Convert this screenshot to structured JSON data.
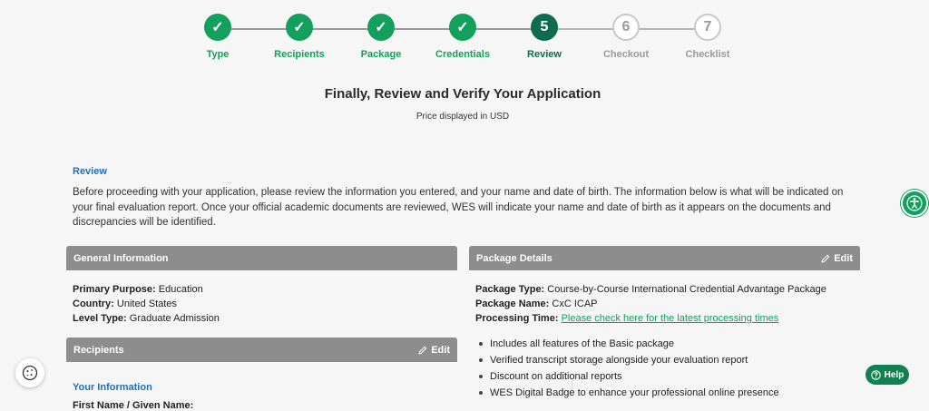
{
  "stepper": {
    "steps": [
      {
        "num": "1",
        "mark": "✓",
        "label": "Type",
        "status": "done"
      },
      {
        "num": "2",
        "mark": "✓",
        "label": "Recipients",
        "status": "done"
      },
      {
        "num": "3",
        "mark": "✓",
        "label": "Package",
        "status": "done"
      },
      {
        "num": "4",
        "mark": "✓",
        "label": "Credentials",
        "status": "done"
      },
      {
        "num": "5",
        "mark": "5",
        "label": "Review",
        "status": "current"
      },
      {
        "num": "6",
        "mark": "6",
        "label": "Checkout",
        "status": "todo"
      },
      {
        "num": "7",
        "mark": "7",
        "label": "Checklist",
        "status": "todo"
      }
    ]
  },
  "page": {
    "title": "Finally, Review and Verify Your Application",
    "price_note": "Price displayed in USD"
  },
  "review": {
    "heading": "Review",
    "text": "Before proceeding with your application, please review the information you entered, and your name and date of birth. The information below is what will be indicated on your final evaluation report. Once your official academic documents are reviewed, WES will indicate your name and date of birth as it appears on the documents and discrepancies will be identified."
  },
  "general_info": {
    "header": "General Information",
    "primary_purpose_label": "Primary Purpose:",
    "primary_purpose": "Education",
    "country_label": "Country:",
    "country": "United States",
    "level_type_label": "Level Type:",
    "level_type": "Graduate Admission"
  },
  "recipients": {
    "header": "Recipients",
    "edit_label": "Edit",
    "your_info_heading": "Your Information",
    "cutoff_text": "First Name / Given Name:"
  },
  "package": {
    "header": "Package Details",
    "edit_label": "Edit",
    "type_label": "Package Type:",
    "type": "Course-by-Course International Credential Advantage Package",
    "name_label": "Package Name:",
    "name": "CxC ICAP",
    "processing_label": "Processing Time:",
    "processing_link": "Please check here for the latest processing times",
    "features": [
      "Includes all features of the Basic package",
      "Verified transcript storage alongside your evaluation report",
      "Discount on additional reports",
      "WES Digital Badge to enhance your professional online presence"
    ]
  },
  "widgets": {
    "help_label": "Help"
  },
  "colors": {
    "accent_green": "#12a05c",
    "current_step": "#0e6b4e",
    "link_blue": "#1f6fbf",
    "card_header_gray": "#8d8d8d"
  },
  "icons": {
    "check": "check-icon",
    "pencil": "pencil-icon",
    "accessibility": "accessibility-icon",
    "cookie": "cookie-icon",
    "help": "question-circle-icon"
  }
}
